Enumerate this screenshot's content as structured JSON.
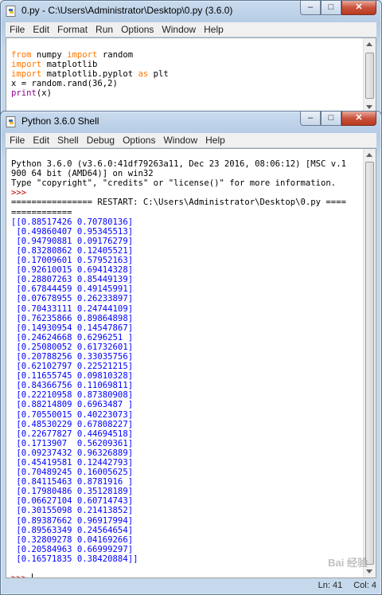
{
  "editor_window": {
    "title": "0.py - C:\\Users\\Administrator\\Desktop\\0.py (3.6.0)",
    "menu": [
      "File",
      "Edit",
      "Format",
      "Run",
      "Options",
      "Window",
      "Help"
    ],
    "code": [
      {
        "kw1": "from",
        "t1": " numpy ",
        "kw2": "import",
        "t2": " random"
      },
      {
        "kw1": "import",
        "t1": " matplotlib",
        "kw2": "",
        "t2": ""
      },
      {
        "kw1": "import",
        "t1": " matplotlib.pyplot ",
        "kw2": "as",
        "t2": " plt"
      },
      {
        "kw1": "",
        "t1": "x = random.rand(36,2)",
        "kw2": "",
        "t2": ""
      },
      {
        "bi": "print",
        "t1": "(x)"
      }
    ]
  },
  "shell_window": {
    "title": "Python 3.6.0 Shell",
    "menu": [
      "File",
      "Edit",
      "Shell",
      "Debug",
      "Options",
      "Window",
      "Help"
    ],
    "banner_1": "Python 3.6.0 (v3.6.0:41df79263a11, Dec 23 2016, 08:06:12) [MSC v.1",
    "banner_2": "900 64 bit (AMD64)] on win32",
    "banner_3": "Type \"copyright\", \"credits\" or \"license()\" for more information.",
    "prompt": ">>> ",
    "restart_1": "================ RESTART: C:\\Users\\Administrator\\Desktop\\0.py ====",
    "restart_2": "============",
    "output": [
      "[[0.88517426 0.70780136]",
      " [0.49860407 0.95345513]",
      " [0.94790881 0.09176279]",
      " [0.83280862 0.12405521]",
      " [0.17009601 0.57952163]",
      " [0.92610015 0.69414328]",
      " [0.28807263 0.85449139]",
      " [0.67844459 0.49145991]",
      " [0.07678955 0.26233897]",
      " [0.70433111 0.24744109]",
      " [0.76235866 0.89864898]",
      " [0.14930954 0.14547867]",
      " [0.24624668 0.6296251 ]",
      " [0.25080052 0.61732601]",
      " [0.20788256 0.33035756]",
      " [0.62102797 0.22521215]",
      " [0.11655745 0.09810328]",
      " [0.84366756 0.11069811]",
      " [0.22210958 0.87380908]",
      " [0.88214809 0.6963487 ]",
      " [0.70550015 0.40223073]",
      " [0.48530229 0.67808227]",
      " [0.22677827 0.44694518]",
      " [0.1713907  0.56209361]",
      " [0.09237432 0.96326889]",
      " [0.45419581 0.12442793]",
      " [0.70489245 0.16005625]",
      " [0.84115463 0.8781916 ]",
      " [0.17980486 0.35128189]",
      " [0.06627104 0.60714743]",
      " [0.30155098 0.21413852]",
      " [0.89387662 0.96917994]",
      " [0.89563349 0.24564654]",
      " [0.32809278 0.04169266]",
      " [0.20584963 0.66999297]",
      " [0.16571835 0.38420884]]"
    ],
    "status_line": "Ln: 41",
    "status_col": "Col: 4"
  },
  "window_controls": {
    "minimize": "–",
    "maximize": "□",
    "close": "✕"
  },
  "watermark": "Bai 经验",
  "colors": {
    "keyword": "#ff7700",
    "builtin": "#900090",
    "output": "#0000ff",
    "prompt": "#c00000"
  }
}
